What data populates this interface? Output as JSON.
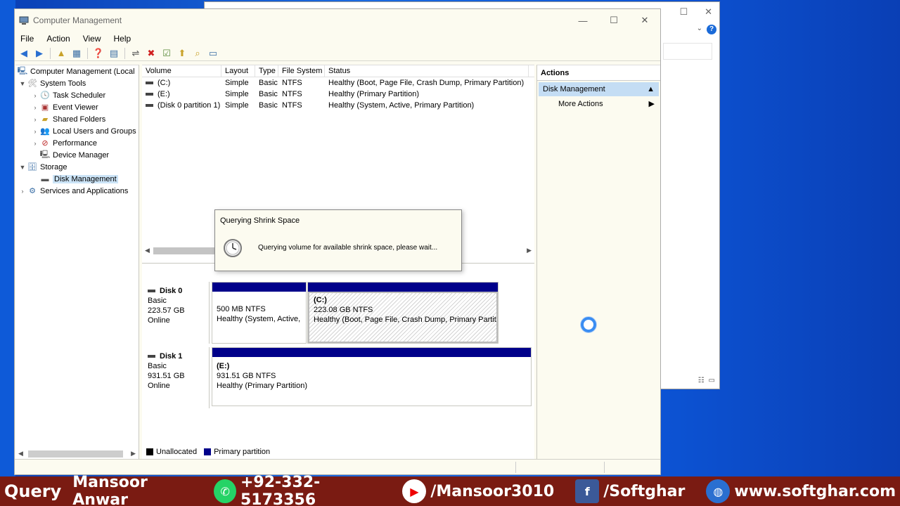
{
  "main_window": {
    "title": "Computer Management",
    "controls": {
      "minimize": "—",
      "maximize": "☐",
      "close": "✕"
    }
  },
  "menu": [
    "File",
    "Action",
    "View",
    "Help"
  ],
  "tree": {
    "root": "Computer Management (Local",
    "items": [
      {
        "label": "System Tools",
        "level": 1,
        "expander": "down",
        "icon": "tools-icon"
      },
      {
        "label": "Task Scheduler",
        "level": 2,
        "expander": "right",
        "icon": "clock-icon"
      },
      {
        "label": "Event Viewer",
        "level": 2,
        "expander": "right",
        "icon": "event-viewer-icon"
      },
      {
        "label": "Shared Folders",
        "level": 2,
        "expander": "right",
        "icon": "shared-folder-icon"
      },
      {
        "label": "Local Users and Groups",
        "level": 2,
        "expander": "right",
        "icon": "users-icon"
      },
      {
        "label": "Performance",
        "level": 2,
        "expander": "right",
        "icon": "performance-icon"
      },
      {
        "label": "Device Manager",
        "level": 2,
        "expander": "",
        "icon": "device-manager-icon"
      },
      {
        "label": "Storage",
        "level": 1,
        "expander": "down",
        "icon": "storage-icon"
      },
      {
        "label": "Disk Management",
        "level": 2,
        "expander": "",
        "icon": "disk-icon",
        "selected": true
      },
      {
        "label": "Services and Applications",
        "level": 1,
        "expander": "right",
        "icon": "services-icon"
      }
    ]
  },
  "volume_table": {
    "headers": [
      "Volume",
      "Layout",
      "Type",
      "File System",
      "Status"
    ],
    "rows": [
      [
        "(C:)",
        "Simple",
        "Basic",
        "NTFS",
        "Healthy (Boot, Page File, Crash Dump, Primary Partition)"
      ],
      [
        "(E:)",
        "Simple",
        "Basic",
        "NTFS",
        "Healthy (Primary Partition)"
      ],
      [
        "(Disk 0 partition 1)",
        "Simple",
        "Basic",
        "NTFS",
        "Healthy (System, Active, Primary Partition)"
      ]
    ]
  },
  "disks": [
    {
      "name": "Disk 0",
      "type": "Basic",
      "size": "223.57 GB",
      "state": "Online",
      "partitions": [
        {
          "label": "",
          "size": "500 MB NTFS",
          "status": "Healthy (System, Active,"
        },
        {
          "label": "(C:)",
          "size": "223.08 GB NTFS",
          "status": "Healthy (Boot, Page File, Crash Dump, Primary Partit"
        }
      ]
    },
    {
      "name": "Disk 1",
      "type": "Basic",
      "size": "931.51 GB",
      "state": "Online",
      "partitions": [
        {
          "label": "(E:)",
          "size": "931.51 GB NTFS",
          "status": "Healthy (Primary Partition)"
        }
      ]
    }
  ],
  "legend": [
    {
      "label": "Unallocated",
      "color": "#000000"
    },
    {
      "label": "Primary partition",
      "color": "#00008a"
    }
  ],
  "actions": {
    "header": "Actions",
    "section": "Disk Management",
    "more": "More Actions"
  },
  "dialog": {
    "title": "Querying Shrink Space",
    "message": "Querying volume for available shrink space, please wait..."
  },
  "banner": {
    "query": "Query",
    "name": "Mansoor Anwar",
    "phone": "+92-332-5173356",
    "youtube": "/Mansoor3010",
    "facebook": "/Softghar",
    "website": "www.softghar.com"
  },
  "colors": {
    "primary_partition": "#00008a",
    "selection": "#cce4f7",
    "actions_selection": "#c4ddf4",
    "banner_bg": "#7a1b12"
  }
}
